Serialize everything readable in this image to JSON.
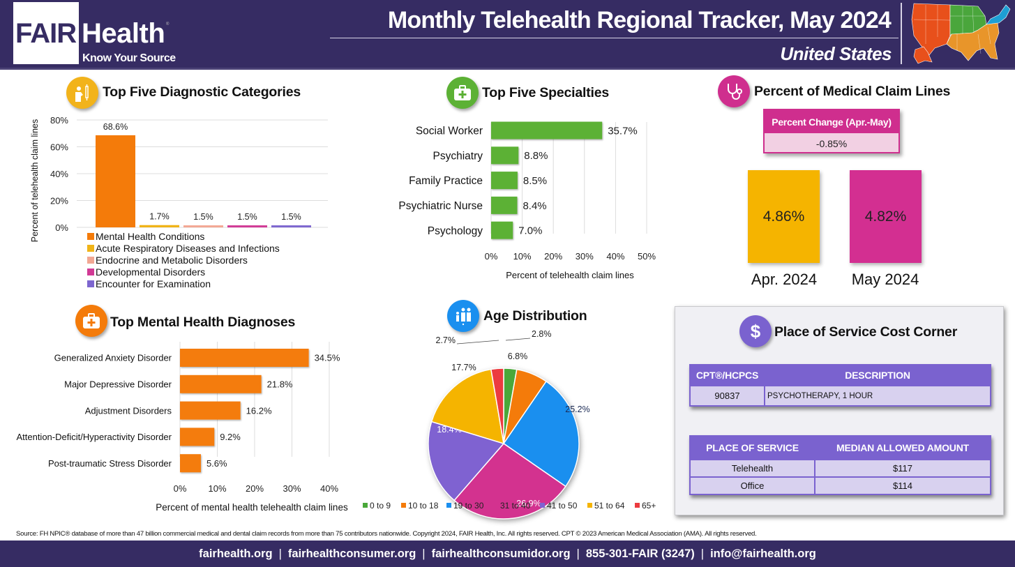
{
  "header": {
    "logo_fair": "FAIR",
    "logo_health": "Health",
    "logo_reg": "®",
    "logo_tagline": "Know Your Source",
    "title": "Monthly Telehealth Regional Tracker, May 2024",
    "region": "United States",
    "map_region_colors": [
      "#e8501b",
      "#4aa63c",
      "#e8952a",
      "#1d9fd4"
    ]
  },
  "sections": {
    "diag_title": "Top Five Diagnostic Categories",
    "spec_title": "Top Five Specialties",
    "claims_title": "Percent of Medical Claim Lines",
    "mental_title": "Top Mental Health Diagnoses",
    "age_title": "Age Distribution",
    "cost_title": "Place of Service Cost Corner"
  },
  "claims": {
    "change_header": "Percent Change (Apr.-May)",
    "change_value": "-0.85%",
    "cards": [
      {
        "label": "Apr. 2024",
        "value": "4.86%",
        "color": "#f5b400"
      },
      {
        "label": "May 2024",
        "value": "4.82%",
        "color": "#d32f91"
      }
    ]
  },
  "cost_corner": {
    "code_table": {
      "headers": [
        "CPT®/HCPCS",
        "DESCRIPTION"
      ],
      "rows": [
        [
          "90837",
          "PSYCHOTHERAPY, 1 HOUR"
        ]
      ]
    },
    "pos_table": {
      "headers": [
        "PLACE OF SERVICE",
        "MEDIAN ALLOWED AMOUNT"
      ],
      "rows": [
        [
          "Telehealth",
          "$117"
        ],
        [
          "Office",
          "$114"
        ]
      ]
    }
  },
  "source_text": "Source: FH NPIC® database of more than 47 billion commercial medical and dental claim records from more than 75 contributors nationwide. Copyright 2024, FAIR Health, Inc. All rights reserved. CPT © 2023 American Medical Association (AMA). All rights reserved.",
  "footer": {
    "links": [
      "fairhealth.org",
      "fairhealthconsumer.org",
      "fairhealthconsumidor.org",
      "855-301-FAIR (3247)",
      "info@fairhealth.org"
    ],
    "separator": "|"
  },
  "chart_data": [
    {
      "id": "diagnostic_categories",
      "type": "bar",
      "title": "Top Five Diagnostic Categories",
      "ylabel": "Percent of telehealth claim lines",
      "xlabel": "",
      "ylim": [
        0,
        80
      ],
      "yticks": [
        "0%",
        "20%",
        "40%",
        "60%",
        "80%"
      ],
      "ytick_values": [
        0,
        20,
        40,
        60,
        80
      ],
      "grid": true,
      "legend_position": "bottom",
      "categories": [
        "Mental Health Conditions",
        "Acute Respiratory Diseases and Infections",
        "Endocrine and Metabolic Disorders",
        "Developmental Disorders",
        "Encounter for Examination"
      ],
      "values": [
        68.6,
        1.7,
        1.5,
        1.5,
        1.5
      ],
      "labels": [
        "68.6%",
        "1.7%",
        "1.5%",
        "1.5%",
        "1.5%"
      ],
      "colors": [
        "#f47b0a",
        "#f0b418",
        "#f2a793",
        "#d13a95",
        "#7d66cf"
      ]
    },
    {
      "id": "specialties",
      "type": "bar",
      "orientation": "horizontal",
      "title": "Top Five Specialties",
      "xlabel": "Percent of telehealth claim lines",
      "xlim": [
        0,
        50
      ],
      "xticks": [
        "0%",
        "10%",
        "20%",
        "30%",
        "40%",
        "50%"
      ],
      "xtick_values": [
        0,
        10,
        20,
        30,
        40,
        50
      ],
      "grid": true,
      "categories": [
        "Social Worker",
        "Psychiatry",
        "Family Practice",
        "Psychiatric Nurse",
        "Psychology"
      ],
      "values": [
        35.7,
        8.8,
        8.5,
        8.4,
        7.0
      ],
      "labels": [
        "35.7%",
        "8.8%",
        "8.5%",
        "8.4%",
        "7.0%"
      ],
      "color": "#5cb135"
    },
    {
      "id": "mental_health_diagnoses",
      "type": "bar",
      "orientation": "horizontal",
      "title": "Top Mental Health Diagnoses",
      "xlabel": "Percent of mental health telehealth claim lines",
      "xlim": [
        0,
        40
      ],
      "xticks": [
        "0%",
        "10%",
        "20%",
        "30%",
        "40%"
      ],
      "xtick_values": [
        0,
        10,
        20,
        30,
        40
      ],
      "grid": true,
      "categories": [
        "Generalized Anxiety Disorder",
        "Major Depressive Disorder",
        "Adjustment Disorders",
        "Attention-Deficit/Hyperactivity Disorder",
        "Post-traumatic Stress Disorder"
      ],
      "values": [
        34.5,
        21.8,
        16.2,
        9.2,
        5.6
      ],
      "labels": [
        "34.5%",
        "21.8%",
        "16.2%",
        "9.2%",
        "5.6%"
      ],
      "color": "#f47b0a"
    },
    {
      "id": "age_distribution",
      "type": "pie",
      "title": "Age Distribution",
      "legend_position": "bottom",
      "categories": [
        "0 to 9",
        "10 to 18",
        "19 to 30",
        "31 to 40",
        "41 to 50",
        "51 to 64",
        "65+"
      ],
      "values": [
        2.8,
        6.8,
        25.2,
        26.9,
        18.4,
        17.7,
        2.7
      ],
      "labels": [
        "2.8%",
        "6.8%",
        "25.2%",
        "26.9%",
        "18.4%",
        "17.7%",
        "2.7%"
      ],
      "colors": [
        "#4aa83a",
        "#f47b0a",
        "#1a8fef",
        "#d3328f",
        "#7f62d1",
        "#f5b400",
        "#ec3b3f"
      ]
    }
  ]
}
